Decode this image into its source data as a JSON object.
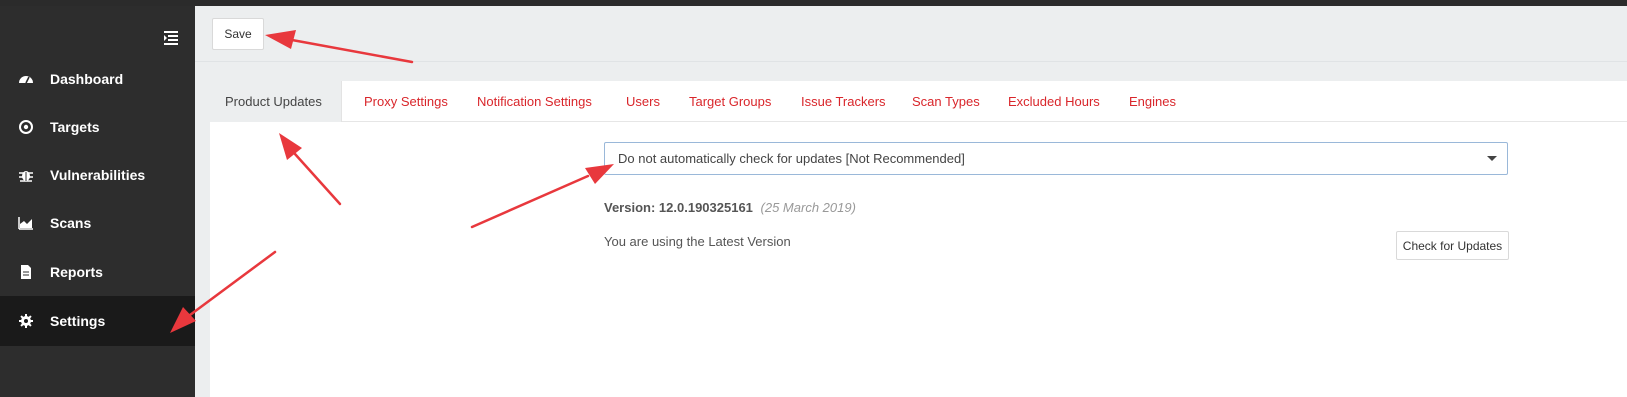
{
  "sidebar": {
    "items": [
      {
        "label": "Dashboard",
        "icon": "dashboard-icon"
      },
      {
        "label": "Targets",
        "icon": "target-icon"
      },
      {
        "label": "Vulnerabilities",
        "icon": "bug-icon"
      },
      {
        "label": "Scans",
        "icon": "area-chart-icon"
      },
      {
        "label": "Reports",
        "icon": "document-icon"
      },
      {
        "label": "Settings",
        "icon": "gear-icon"
      }
    ],
    "active": "Settings"
  },
  "toolbar": {
    "save_label": "Save"
  },
  "tabs": [
    {
      "label": "Product Updates"
    },
    {
      "label": "Proxy Settings"
    },
    {
      "label": "Notification Settings"
    },
    {
      "label": "Users"
    },
    {
      "label": "Target Groups"
    },
    {
      "label": "Issue Trackers"
    },
    {
      "label": "Scan Types"
    },
    {
      "label": "Excluded Hours"
    },
    {
      "label": "Engines"
    }
  ],
  "updates": {
    "selected_option": "Do not automatically check for updates [Not Recommended]",
    "version_label": "Version:",
    "version_number": "12.0.190325161",
    "version_date": "(25 March 2019)",
    "status": "You are using the Latest Version",
    "check_button": "Check for Updates"
  },
  "colors": {
    "accent": "#d9262b",
    "sidebar_bg": "#2d2d2d",
    "sidebar_active": "#1a1a1a",
    "annotation_arrow": "#e8383d"
  }
}
